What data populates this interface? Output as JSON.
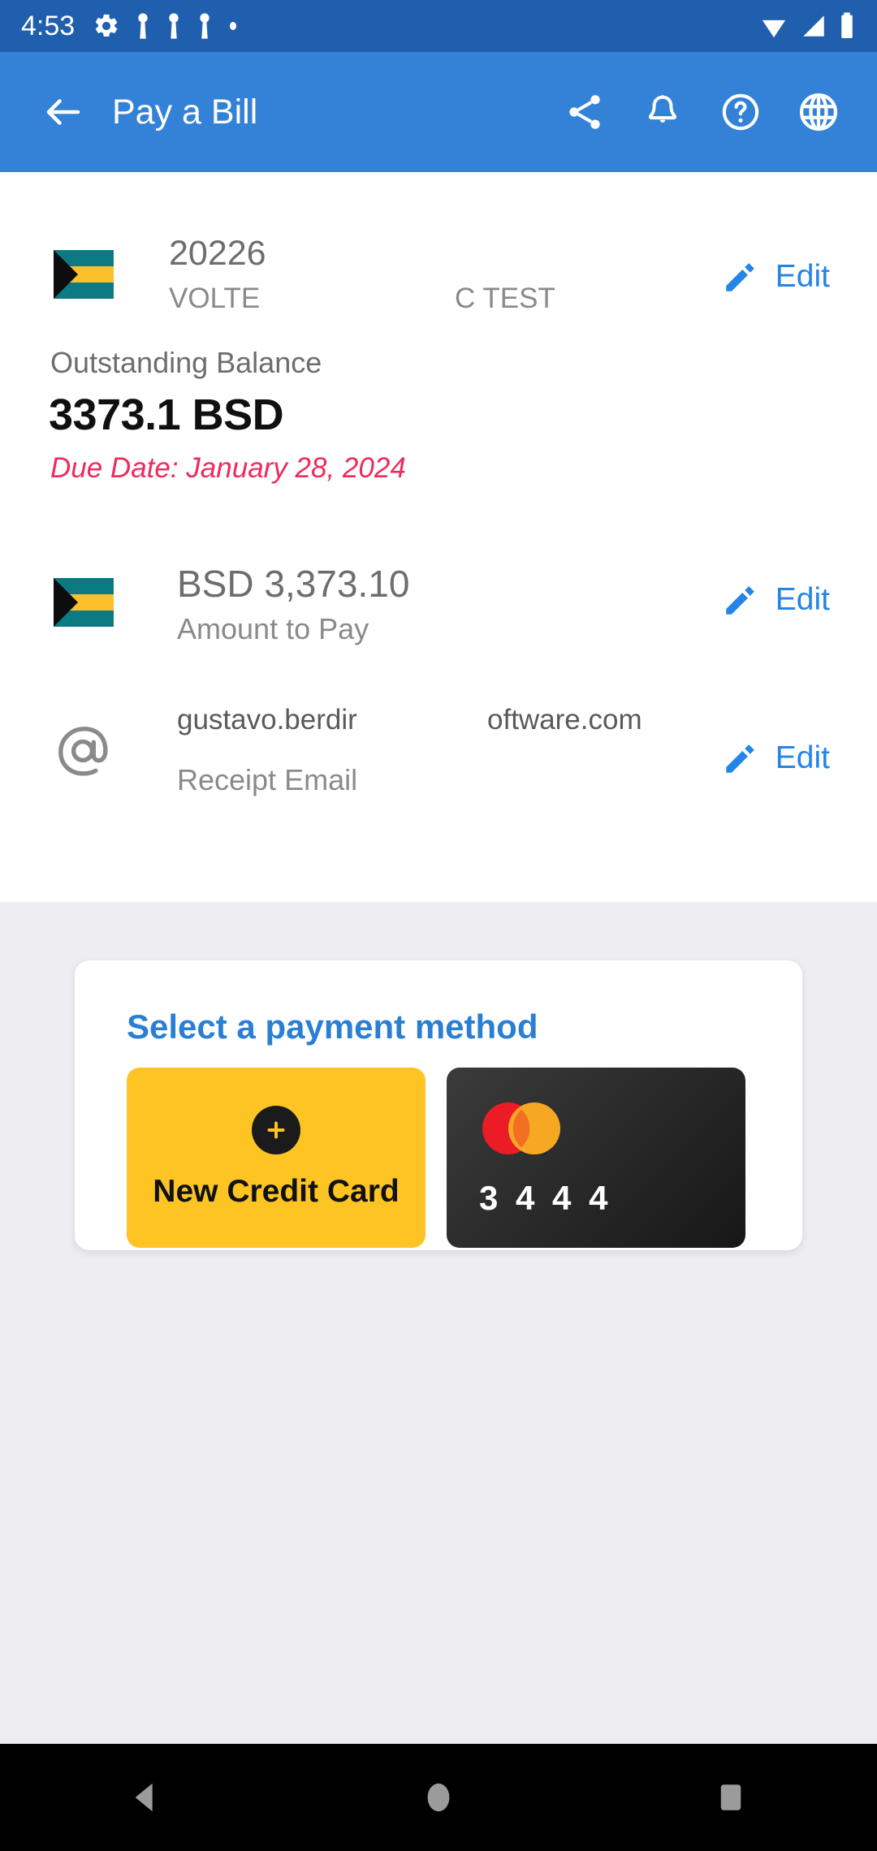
{
  "status_bar": {
    "time": "4:53",
    "left_icons": [
      "gear-icon",
      "key-icon",
      "key-icon",
      "key-icon",
      "dot-icon"
    ],
    "right_icons": [
      "wifi-icon",
      "signal-icon",
      "battery-icon"
    ],
    "background": "#1f5fae"
  },
  "app_bar": {
    "title": "Pay a Bill",
    "back_icon": "arrow-back-icon",
    "background": "#3482d8",
    "actions": [
      {
        "name": "share-icon",
        "label": "Share"
      },
      {
        "name": "notifications-icon",
        "label": "Notifications"
      },
      {
        "name": "help-icon",
        "label": "Help"
      },
      {
        "name": "language-icon",
        "label": "Language"
      }
    ]
  },
  "account": {
    "flag": "bahamas-flag-icon",
    "number": "20226",
    "subtitle": "VOLTE",
    "subtitle_tail": "C TEST",
    "edit_label": "Edit",
    "edit_icon": "pencil-icon"
  },
  "balance": {
    "label": "Outstanding Balance",
    "amount": "3373.1 BSD",
    "due_date": "Due Date: January 28, 2024",
    "due_color": "#ef2b5b"
  },
  "amount_to_pay": {
    "flag": "bahamas-flag-icon",
    "value": "BSD 3,373.10",
    "label": "Amount to Pay",
    "edit_label": "Edit",
    "edit_icon": "pencil-icon"
  },
  "receipt_email": {
    "icon": "at-sign-icon",
    "value": "gustavo.berdir",
    "value_tail": "oftware.com",
    "label": "Receipt Email",
    "edit_label": "Edit",
    "edit_icon": "pencil-icon"
  },
  "payment_method": {
    "title": "Select a payment method",
    "title_color": "#2a7fd4",
    "tiles": [
      {
        "type": "new",
        "label": "New Credit Card",
        "icon": "plus-icon",
        "background": "#fdc424"
      },
      {
        "type": "saved",
        "label": "3 4 4 4",
        "brand_icon": "mastercard-icon",
        "background": "#1f1f1f"
      }
    ]
  },
  "nav_bar": {
    "background": "#000000",
    "buttons": [
      {
        "name": "nav-back-button",
        "icon": "triangle-back-icon"
      },
      {
        "name": "nav-home-button",
        "icon": "circle-home-icon"
      },
      {
        "name": "nav-recents-button",
        "icon": "square-recents-icon"
      }
    ]
  }
}
